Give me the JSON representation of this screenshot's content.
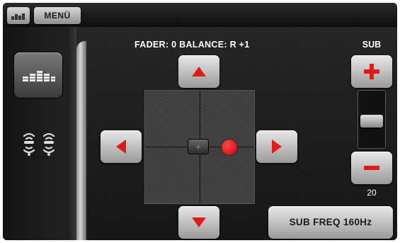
{
  "header": {
    "menu_label": "MENÜ"
  },
  "main": {
    "title": "FADER: 0 BALANCE: R +1"
  },
  "sub": {
    "label": "SUB",
    "value": "20",
    "level_fraction": 0.45
  },
  "sub_freq_button": "SUB FREQ 160Hz",
  "colors": {
    "accent_red": "#e11b1b",
    "button_light": "#e8e8e8",
    "background": "#1c1c1c"
  },
  "icons": [
    "equalizer-icon",
    "bluetooth-sound-icon",
    "arrow-up-icon",
    "arrow-down-icon",
    "arrow-left-icon",
    "arrow-right-icon",
    "plus-icon",
    "minus-icon"
  ]
}
